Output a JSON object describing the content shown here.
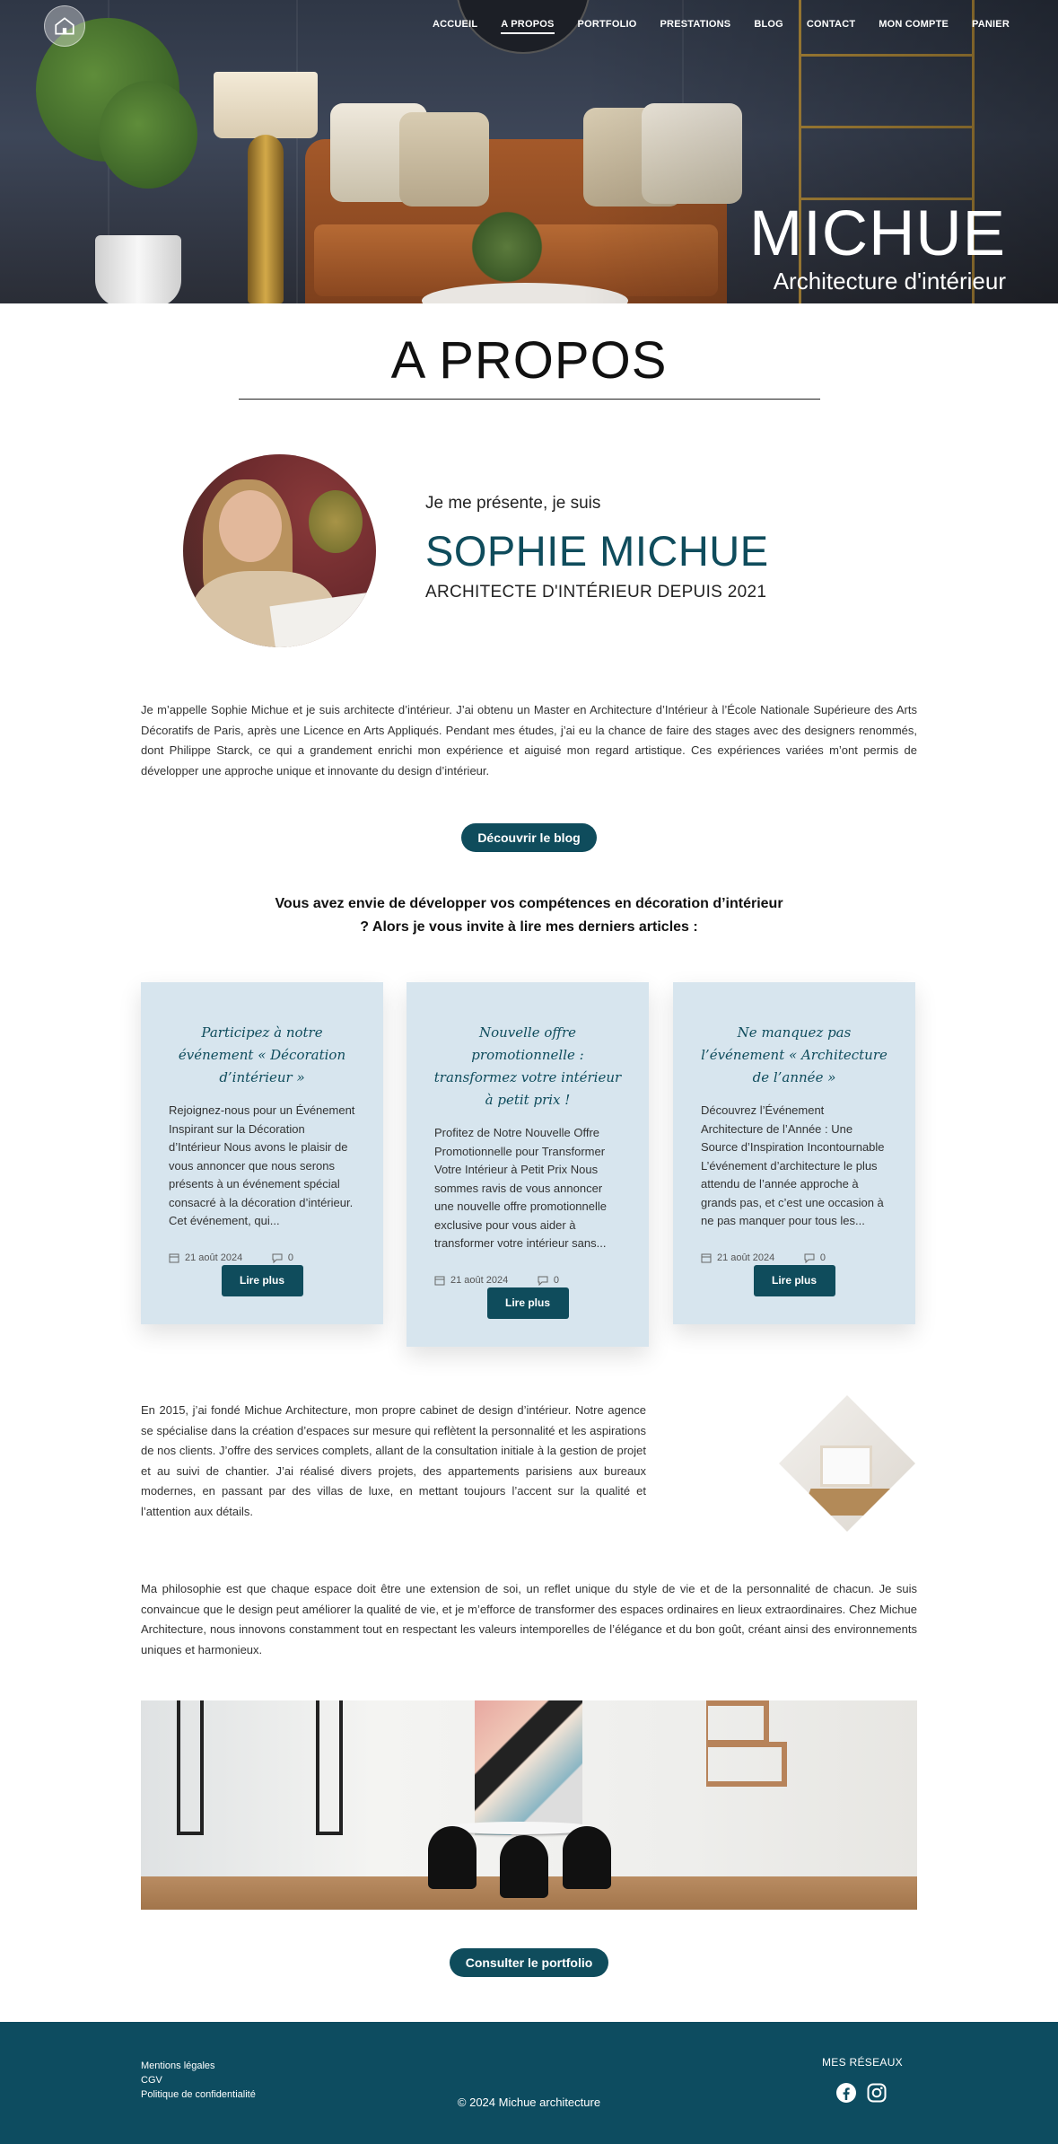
{
  "nav": {
    "items": [
      "ACCUEIL",
      "A PROPOS",
      "PORTFOLIO",
      "PRESTATIONS",
      "BLOG",
      "CONTACT",
      "MON COMPTE",
      "PANIER"
    ],
    "active": "A PROPOS"
  },
  "hero": {
    "brand": "MICHUE",
    "subtitle": "Architecture d'intérieur"
  },
  "page_title": "A PROPOS",
  "intro": {
    "pre": "Je me présente, je suis",
    "name": "SOPHIE MICHUE",
    "role": "ARCHITECTE D'INTÉRIEUR DEPUIS 2021"
  },
  "paragraph1": "Je m’appelle Sophie Michue et je suis architecte d’intérieur. J’ai obtenu un Master en Architecture d’Intérieur à l’École Nationale Supérieure des Arts Décoratifs de Paris, après une Licence en Arts Appliqués. Pendant mes études, j’ai eu la chance de faire des stages avec des designers renommés, dont Philippe Starck, ce qui a grandement enrichi mon expérience et aiguisé mon regard artistique. Ces expériences variées m’ont permis de développer une approche unique et innovante du design d’intérieur.",
  "blog_button": "Découvrir le blog",
  "invite": "Vous avez envie de développer vos compétences en décoration d’intérieur ? Alors je vous invite à lire mes derniers articles :",
  "articles": [
    {
      "title": "Participez à notre événement « Décoration d’intérieur »",
      "excerpt": "Rejoignez-nous pour un Événement Inspirant sur la Décoration d’Intérieur Nous avons le plaisir de vous annoncer que nous serons présents à un événement spécial consacré à la décoration d’intérieur. Cet événement, qui...",
      "date": "21 août 2024",
      "comments": "0",
      "button": "Lire plus"
    },
    {
      "title": "Nouvelle offre promotionnelle : transformez votre intérieur à petit prix !",
      "excerpt": "Profitez de Notre Nouvelle Offre Promotionnelle pour Transformer Votre Intérieur à Petit Prix Nous sommes ravis de vous annoncer une nouvelle offre promotionnelle exclusive pour vous aider à transformer votre intérieur sans...",
      "date": "21 août 2024",
      "comments": "0",
      "button": "Lire plus"
    },
    {
      "title": "Ne manquez pas l’événement « Architecture de l’année »",
      "excerpt": "Découvrez l’Événement Architecture de l’Année : Une Source d’Inspiration Incontournable L’événement d’architecture le plus attendu de l’année approche à grands pas, et c’est une occasion à ne pas manquer pour tous les...",
      "date": "21 août 2024",
      "comments": "0",
      "button": "Lire plus"
    }
  ],
  "paragraph2": "En 2015, j’ai fondé Michue Architecture, mon propre cabinet de design d’intérieur. Notre agence se spécialise dans la création d’espaces sur mesure qui reflètent la personnalité et les aspirations de nos clients. J’offre des services complets, allant de la consultation initiale à la gestion de projet et au suivi de chantier. J’ai réalisé divers projets, des appartements parisiens aux bureaux modernes, en passant par des villas de luxe, en mettant toujours l’accent sur la qualité et l’attention aux détails.",
  "paragraph3": "Ma philosophie est que chaque espace doit être une extension de soi, un reflet unique du style de vie et de la personnalité de chacun. Je suis convaincue que le design peut améliorer la qualité de vie, et je m’efforce de transformer des espaces ordinaires en lieux extraordinaires. Chez Michue Architecture, nous innovons constamment tout en respectant les valeurs intemporelles de l’élégance et du bon goût, créant ainsi des environnements uniques et harmonieux.",
  "portfolio_button": "Consulter le portfolio",
  "footer": {
    "links": [
      "Mentions légales",
      "CGV",
      "Politique de confidentialité"
    ],
    "copyright": "© 2024 Michue architecture",
    "social_title": "MES RÉSEAUX",
    "social_icons": [
      "facebook-icon",
      "instagram-icon"
    ]
  },
  "colors": {
    "accent": "#0f4c5c",
    "card_bg": "#d7e5ee",
    "footer_bg": "#0d4c60"
  }
}
